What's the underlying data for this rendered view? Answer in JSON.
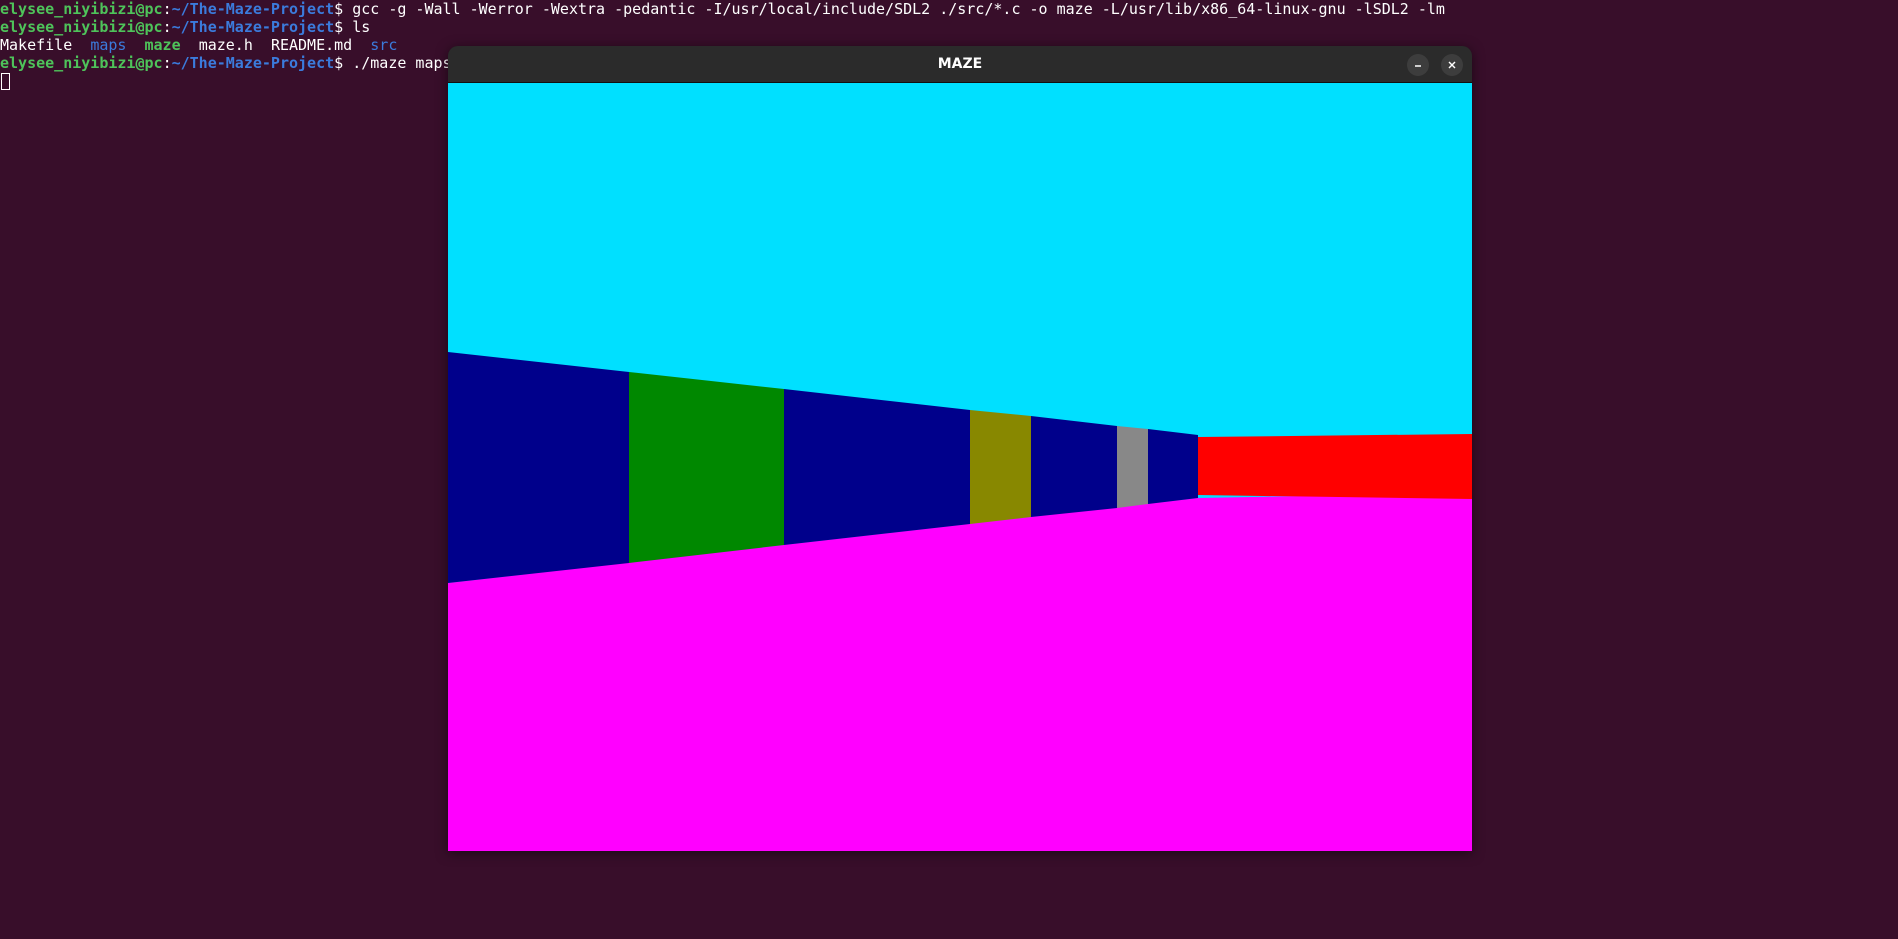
{
  "terminal": {
    "lines": [
      {
        "user": "elysee_niyibizi@pc",
        "sep": ":",
        "path": "~/The-Maze-Project",
        "dollar": "$ ",
        "command": "gcc -g -Wall -Werror -Wextra -pedantic -I/usr/local/include/SDL2 ./src/*.c -o maze -L/usr/lib/x86_64-linux-gnu -lSDL2 -lm"
      },
      {
        "user": "elysee_niyibizi@pc",
        "sep": ":",
        "path": "~/The-Maze-Project",
        "dollar": "$ ",
        "command": "ls"
      },
      {
        "user": "elysee_niyibizi@pc",
        "sep": ":",
        "path": "~/The-Maze-Project",
        "dollar": "$ ",
        "command": "./maze maps"
      }
    ],
    "ls_output": {
      "makefile": "Makefile",
      "maps": "maps",
      "maze": "maze",
      "maze_h": "maze.h",
      "readme": "README.md",
      "src": "src"
    }
  },
  "window": {
    "title": "MAZE",
    "minimize_icon": "minimize-icon",
    "close_icon": "close-icon"
  },
  "scene": {
    "colors": {
      "sky": "#00e0ff",
      "floor": "#ff00ff",
      "wall_blue": "#00008b",
      "wall_green": "#008800",
      "wall_olive": "#888800",
      "wall_gray": "#888888",
      "wall_red": "#ff0000"
    }
  }
}
